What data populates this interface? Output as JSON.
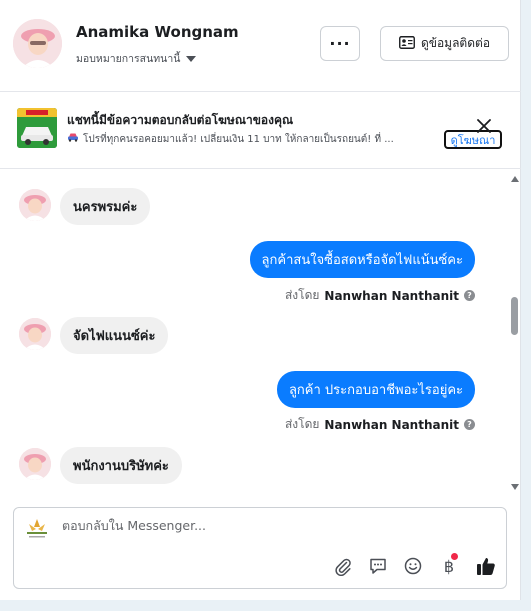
{
  "header": {
    "contact_name": "Anamika Wongnam",
    "assign_label": "มอบหมายการสนทนานี้",
    "more_label": "···",
    "contact_info_label": "ดูข้อมูลติดต่อ"
  },
  "ad": {
    "title": "แชทนี้มีข้อความตอบกลับต่อโฆษณาของคุณ",
    "subtitle": "โปรที่ทุกคนรอคอยมาแล้ว! เปลี่ยนเงิน 11 บาท ให้กลายเป็นรถยนต์! ที่ ...",
    "view_ad_label": "ดูโฆษณา"
  },
  "messages": [
    {
      "direction": "in",
      "text": "นครพรมค่ะ"
    },
    {
      "direction": "out",
      "text": "ลูกค้าสนใจซื้อสดหรือจัดไฟแน้นซ์คะ",
      "sent_by_prefix": "ส่งโดย",
      "sent_by_name": "Nanwhan Nanthanit"
    },
    {
      "direction": "in",
      "text": "จัดไฟแนนซ์ค่ะ"
    },
    {
      "direction": "out",
      "text": "ลูกค้า ประกอบอาชีพอะไรอยู่คะ",
      "sent_by_prefix": "ส่งโดย",
      "sent_by_name": "Nanwhan Nanthanit"
    },
    {
      "direction": "in",
      "text": "พนักงานบริษัทค่ะ"
    }
  ],
  "composer": {
    "placeholder": "ตอบกลับใน Messenger...",
    "tools": [
      "paperclip-icon",
      "saved-replies-icon",
      "emoji-icon",
      "baht-payment-icon",
      "thumbs-up-icon"
    ],
    "baht_glyph": "฿"
  },
  "colors": {
    "outgoing_bubble": "#0a7cff",
    "incoming_bubble": "#f0f0f0",
    "notification_dot": "#f02849"
  }
}
